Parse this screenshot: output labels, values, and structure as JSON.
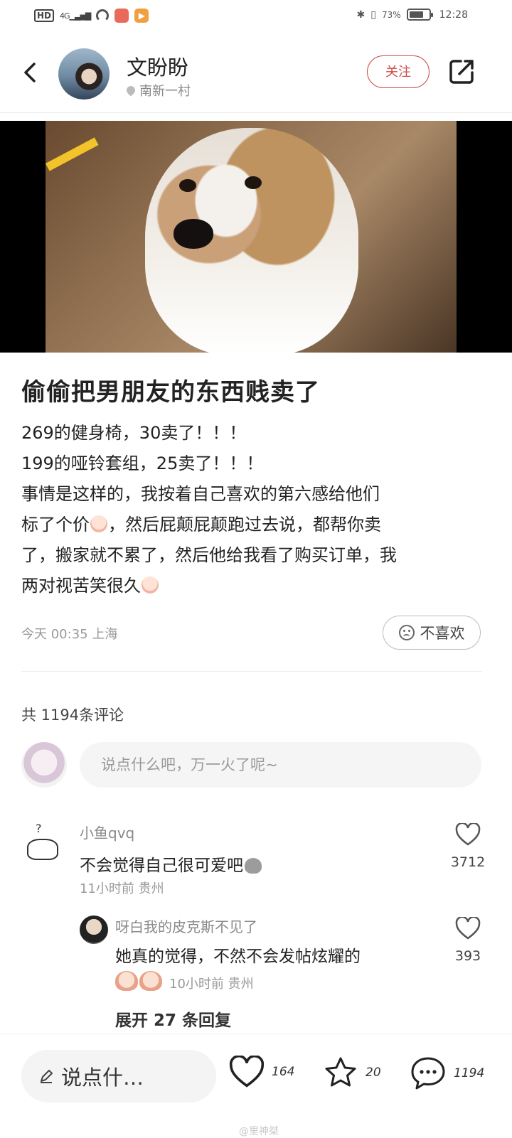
{
  "status_bar": {
    "hd_badge": "HD",
    "network": "4G",
    "battery_pct": "73%",
    "battery_level": 0.73,
    "time": "12:28"
  },
  "header": {
    "author_name": "文盼盼",
    "location": "南新一村",
    "follow_label": "关注"
  },
  "post": {
    "title": "偷偷把男朋友的东西贱卖了",
    "body_lines": [
      "269的健身椅，30卖了！！！",
      "199的哑铃套组，25卖了！！！",
      "事情是这样的，我按着自己喜欢的第六感给他们",
      "标了个价",
      "，然后屁颠屁颠跑过去说，都帮你卖",
      "了，搬家就不累了，然后他给我看了购买订单，我",
      "两对视苦笑很久"
    ],
    "meta": "今天 00:35 上海",
    "dislike_label": "不喜欢"
  },
  "comments": {
    "count_label": "共 1194条评论",
    "input_placeholder": "说点什么吧，万一火了呢~",
    "items": [
      {
        "user": "小鱼qvq",
        "text": "不会觉得自己很可爱吧",
        "meta": "11小时前  贵州",
        "likes": "3712"
      },
      {
        "user": "呀白我的皮克斯不见了",
        "text": "她真的觉得，不然不会发帖炫耀的",
        "meta": "10小时前  贵州",
        "likes": "393"
      }
    ],
    "expand_label": "展开 27 条回复"
  },
  "bottom_bar": {
    "input_label": "说点什…",
    "likes": "164",
    "stars": "20",
    "comments": "1194",
    "watermark": "@里神桀"
  }
}
